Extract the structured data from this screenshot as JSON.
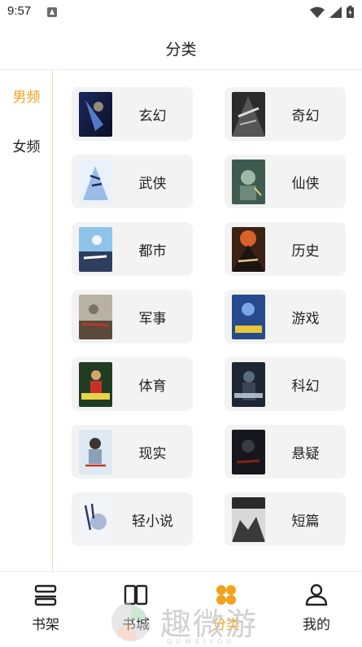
{
  "status_bar": {
    "time": "9:57",
    "icons": [
      "app-notification-icon",
      "wifi-icon",
      "signal-icon",
      "battery-icon"
    ]
  },
  "header": {
    "title": "分类"
  },
  "sidebar": {
    "items": [
      {
        "label": "男频",
        "active": true
      },
      {
        "label": "女频",
        "active": false
      }
    ]
  },
  "categories": [
    {
      "label": "玄幻"
    },
    {
      "label": "奇幻"
    },
    {
      "label": "武侠"
    },
    {
      "label": "仙侠"
    },
    {
      "label": "都市"
    },
    {
      "label": "历史"
    },
    {
      "label": "军事"
    },
    {
      "label": "游戏"
    },
    {
      "label": "体育"
    },
    {
      "label": "科幻"
    },
    {
      "label": "现实"
    },
    {
      "label": "悬疑"
    },
    {
      "label": "轻小说"
    },
    {
      "label": "短篇"
    }
  ],
  "bottom_nav": {
    "items": [
      {
        "label": "书架",
        "icon": "bookshelf-icon"
      },
      {
        "label": "书城",
        "icon": "bookstore-icon"
      },
      {
        "label": "分类",
        "icon": "category-icon",
        "active": true
      },
      {
        "label": "我的",
        "icon": "profile-icon"
      }
    ]
  },
  "watermark": {
    "text": "趣微游",
    "sub": "QUWEIYOU"
  },
  "colors": {
    "accent": "#f2a21c",
    "card_bg": "#f3f3f3",
    "text": "#222222"
  }
}
